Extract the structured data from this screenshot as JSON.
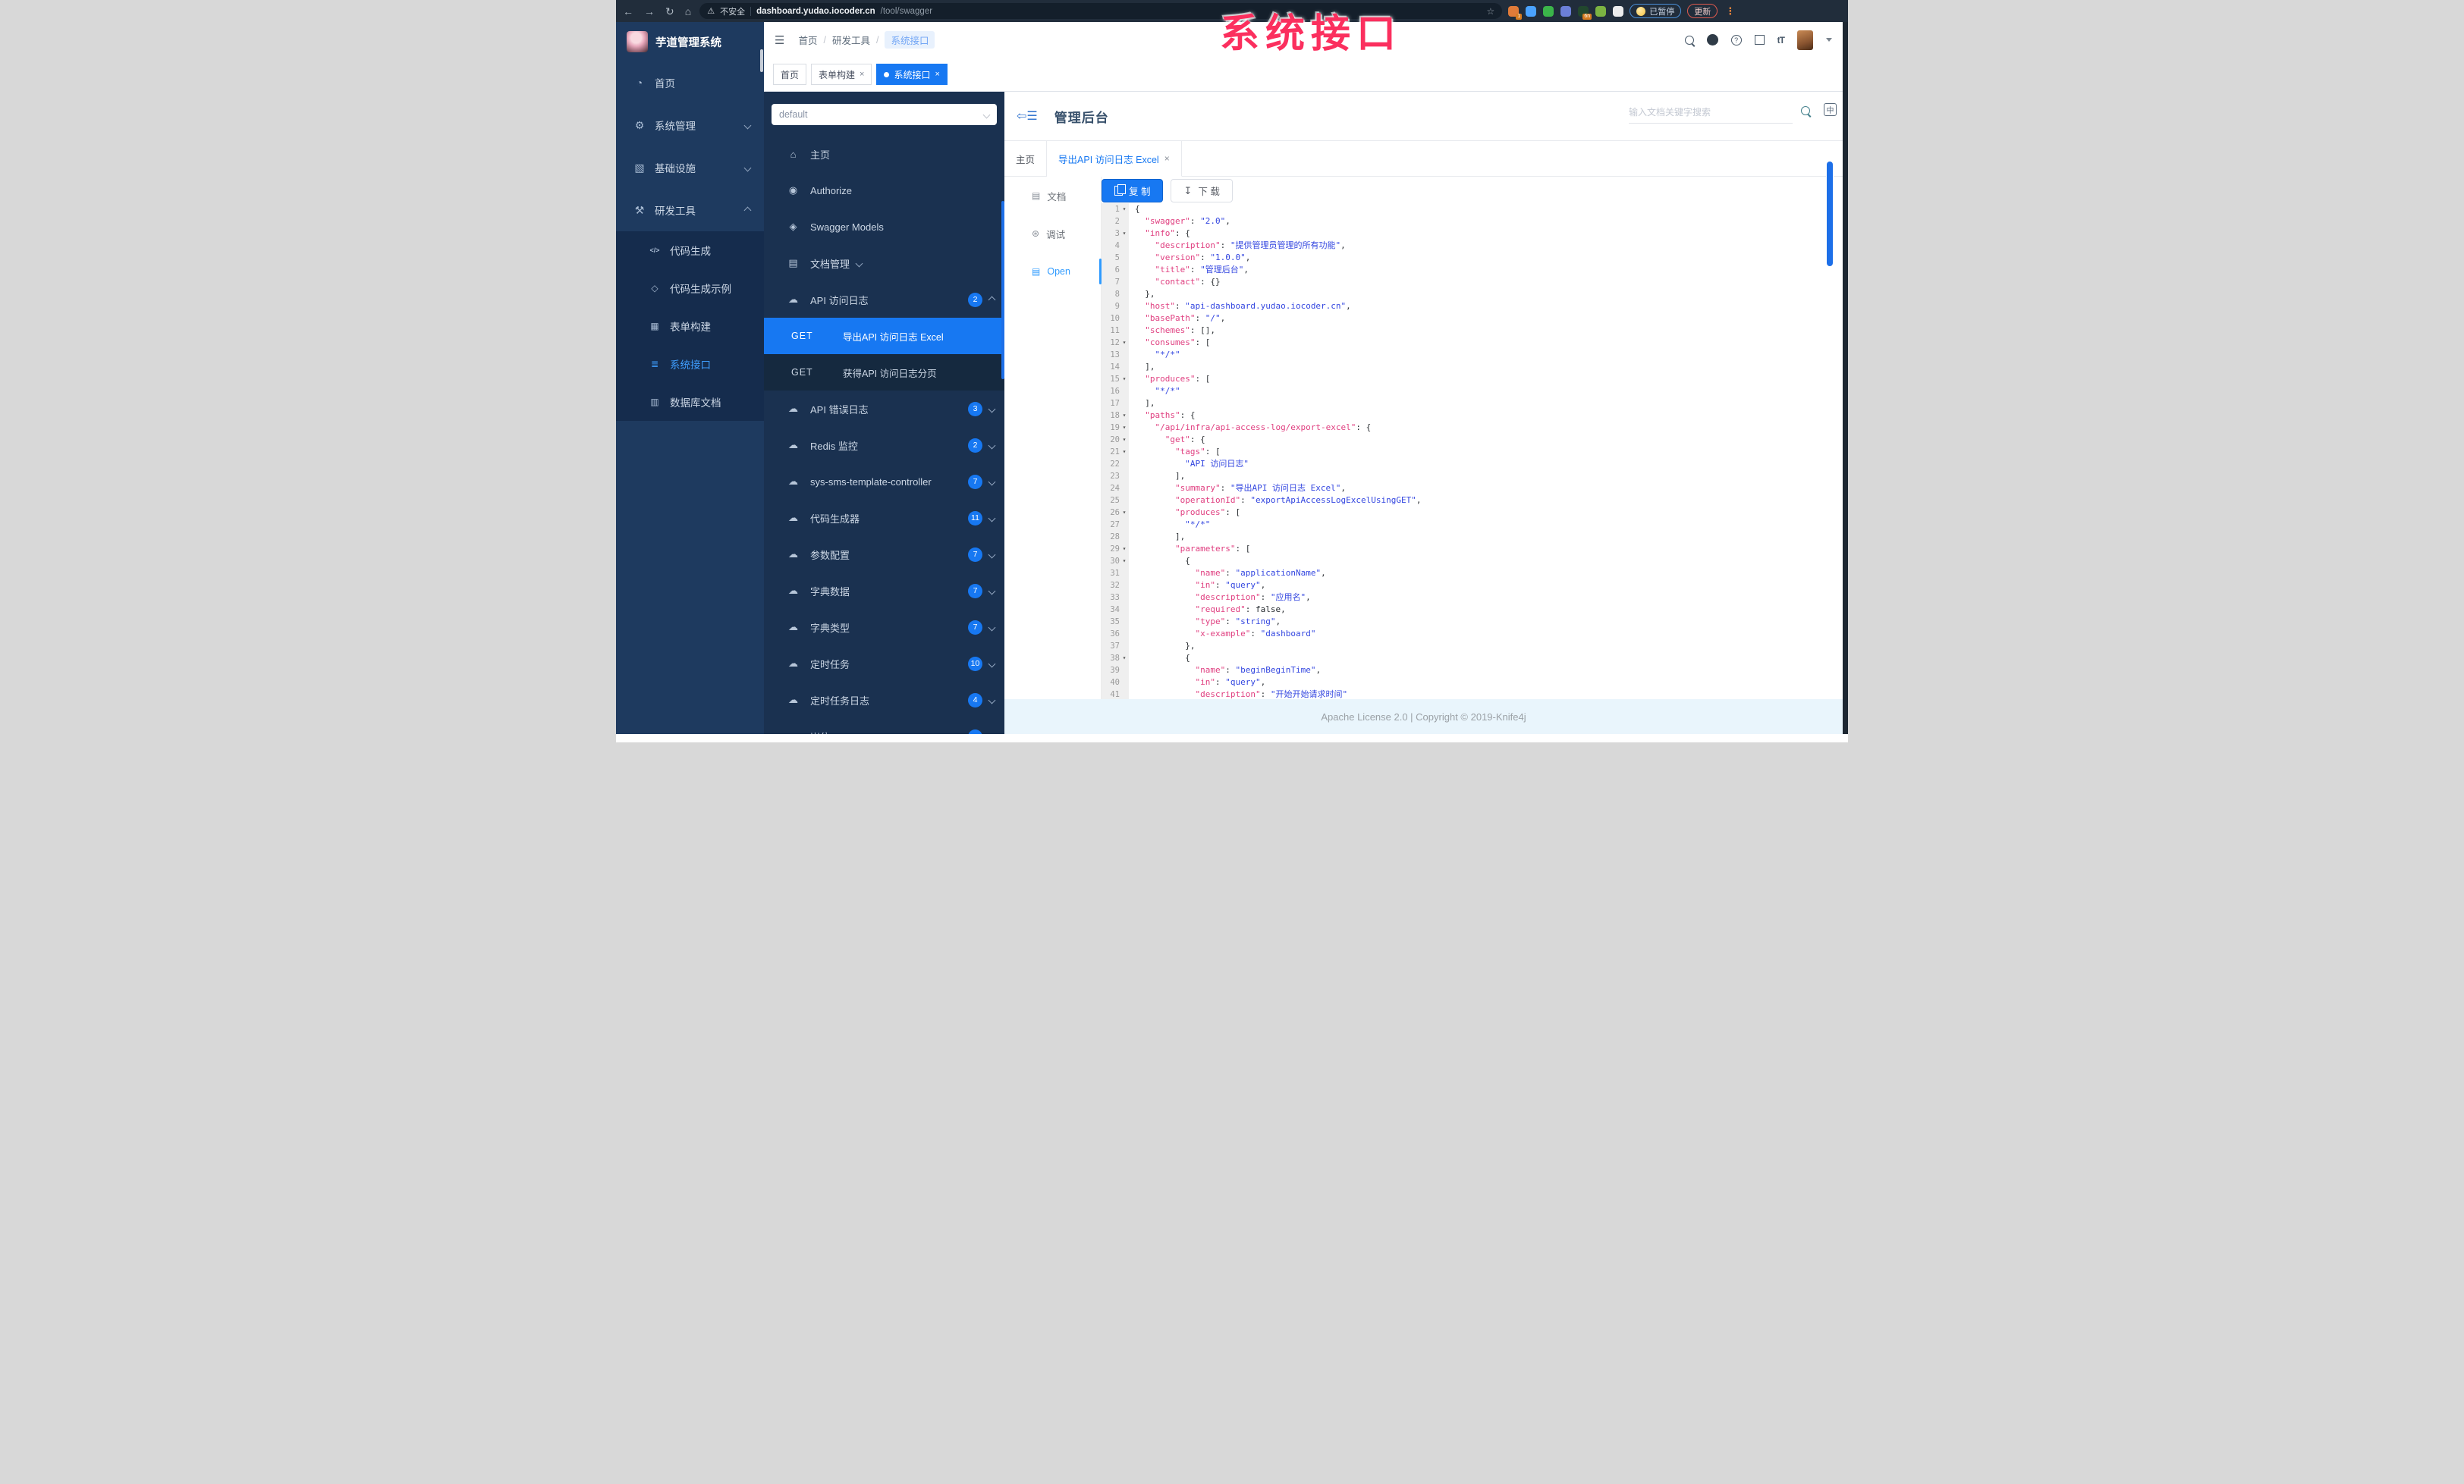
{
  "colors": {
    "accent": "#1778f2",
    "browser-bg": "#212d3b",
    "sidebar-bg": "#1e3a5f",
    "submenu-bg": "#152c4d",
    "panel-bg": "#1a3150",
    "panel-children-bg": "#15293f",
    "active-text": "#3f9eff",
    "overlay-pink": "#fb2f5e",
    "code-key": "#e03f80",
    "code-string": "#3346e0",
    "code-punct": "#2f3337",
    "footer-bg": "#e9f5fc"
  },
  "overlay": {
    "title": "系统接口"
  },
  "browser": {
    "security_label": "不安全",
    "url_host": "dashboard.yudao.iocoder.cn",
    "url_path": "/tool/swagger",
    "paused_label": "已暂停",
    "update_label": "更新",
    "extensions": [
      {
        "name": "extension-1",
        "color": "#e07b39",
        "badge": "1"
      },
      {
        "name": "extension-2",
        "color": "#4aa3ff",
        "badge": null
      },
      {
        "name": "extension-3",
        "color": "#3bb54a",
        "badge": null
      },
      {
        "name": "extension-4",
        "color": "#6b7fd7",
        "badge": null
      },
      {
        "name": "extension-5",
        "color": "#22472e",
        "badge": "6n"
      },
      {
        "name": "extension-6",
        "color": "#7cb342",
        "badge": null
      },
      {
        "name": "extension-7",
        "color": "#ececec",
        "badge": null
      }
    ]
  },
  "app": {
    "logo_title": "芋道管理系统",
    "breadcrumb": [
      "首页",
      "研发工具",
      "系统接口"
    ],
    "page_tabs": [
      {
        "label": "首页",
        "closable": false,
        "active": false
      },
      {
        "label": "表单构建",
        "closable": true,
        "active": false
      },
      {
        "label": "系统接口",
        "closable": true,
        "active": true
      }
    ],
    "sidebar": {
      "items": [
        {
          "label": "首页",
          "icon": "dashboard-icon",
          "chevron": null
        },
        {
          "label": "系统管理",
          "icon": "gear-icon",
          "chevron": "down"
        },
        {
          "label": "基础设施",
          "icon": "infra-icon",
          "chevron": "down"
        },
        {
          "label": "研发工具",
          "icon": "tools-icon",
          "chevron": "up"
        }
      ],
      "sub_items": [
        {
          "label": "代码生成",
          "icon": "code-icon",
          "active": false
        },
        {
          "label": "代码生成示例",
          "icon": "cube-icon",
          "active": false
        },
        {
          "label": "表单构建",
          "icon": "form-icon",
          "active": false
        },
        {
          "label": "系统接口",
          "icon": "api-icon",
          "active": true
        },
        {
          "label": "数据库文档",
          "icon": "database-icon",
          "active": false
        }
      ]
    },
    "swagger_panel": {
      "group_select": "default",
      "nav": [
        {
          "label": "主页",
          "icon": "home-icon"
        },
        {
          "label": "Authorize",
          "icon": "lock-icon"
        },
        {
          "label": "Swagger Models",
          "icon": "models-icon"
        },
        {
          "label": "文档管理",
          "icon": "docs-icon",
          "chevron": "down"
        }
      ],
      "api_groups": [
        {
          "type": "group",
          "label": "API 访问日志",
          "count": "2",
          "chevron": "up"
        },
        {
          "type": "op",
          "method": "GET",
          "label": "导出API 访问日志 Excel",
          "active": true
        },
        {
          "type": "op",
          "method": "GET",
          "label": "获得API 访问日志分页",
          "active": false
        },
        {
          "type": "group",
          "label": "API 错误日志",
          "count": "3",
          "chevron": "down"
        },
        {
          "type": "group",
          "label": "Redis 监控",
          "count": "2",
          "chevron": "down"
        },
        {
          "type": "group",
          "label": "sys-sms-template-controller",
          "count": "7",
          "chevron": "down"
        },
        {
          "type": "group",
          "label": "代码生成器",
          "count": "11",
          "chevron": "down"
        },
        {
          "type": "group",
          "label": "参数配置",
          "count": "7",
          "chevron": "down"
        },
        {
          "type": "group",
          "label": "字典数据",
          "count": "7",
          "chevron": "down"
        },
        {
          "type": "group",
          "label": "字典类型",
          "count": "7",
          "chevron": "down"
        },
        {
          "type": "group",
          "label": "定时任务",
          "count": "10",
          "chevron": "down"
        },
        {
          "type": "group",
          "label": "定时任务日志",
          "count": "4",
          "chevron": "down"
        },
        {
          "type": "group",
          "label": "岗位",
          "count": "",
          "chevron": "down"
        }
      ]
    },
    "main": {
      "title": "管理后台",
      "search_placeholder": "输入文档关键字搜索",
      "lang_icon_label": "中",
      "doc_tabs": [
        {
          "label": "主页",
          "closable": false,
          "active": false
        },
        {
          "label": "导出API 访问日志 Excel",
          "closable": true,
          "active": true
        }
      ],
      "side_tabs": [
        {
          "label": "文档",
          "icon": "document-icon",
          "active": false
        },
        {
          "label": "调试",
          "icon": "bug-icon",
          "active": false
        },
        {
          "label": "Open",
          "icon": "open-file-icon",
          "active": true
        }
      ],
      "copy_label": "复 制",
      "download_label": "下 载",
      "footer": "Apache License 2.0 | Copyright © 2019-Knife4j"
    }
  },
  "code": {
    "lines": [
      {
        "n": 1,
        "i": 0,
        "f": 1,
        "t": [
          [
            "p",
            "{"
          ]
        ]
      },
      {
        "n": 2,
        "i": 2,
        "f": 0,
        "t": [
          [
            "k",
            "\"swagger\""
          ],
          [
            "p",
            ": "
          ],
          [
            "s",
            "\"2.0\""
          ],
          [
            "p",
            ","
          ]
        ]
      },
      {
        "n": 3,
        "i": 2,
        "f": 1,
        "t": [
          [
            "k",
            "\"info\""
          ],
          [
            "p",
            ": {"
          ]
        ]
      },
      {
        "n": 4,
        "i": 4,
        "f": 0,
        "t": [
          [
            "k",
            "\"description\""
          ],
          [
            "p",
            ": "
          ],
          [
            "s",
            "\"提供管理员管理的所有功能\""
          ],
          [
            "p",
            ","
          ]
        ]
      },
      {
        "n": 5,
        "i": 4,
        "f": 0,
        "t": [
          [
            "k",
            "\"version\""
          ],
          [
            "p",
            ": "
          ],
          [
            "s",
            "\"1.0.0\""
          ],
          [
            "p",
            ","
          ]
        ]
      },
      {
        "n": 6,
        "i": 4,
        "f": 0,
        "t": [
          [
            "k",
            "\"title\""
          ],
          [
            "p",
            ": "
          ],
          [
            "s",
            "\"管理后台\""
          ],
          [
            "p",
            ","
          ]
        ]
      },
      {
        "n": 7,
        "i": 4,
        "f": 0,
        "t": [
          [
            "k",
            "\"contact\""
          ],
          [
            "p",
            ": {}"
          ]
        ]
      },
      {
        "n": 8,
        "i": 2,
        "f": 0,
        "t": [
          [
            "p",
            "},"
          ]
        ]
      },
      {
        "n": 9,
        "i": 2,
        "f": 0,
        "t": [
          [
            "k",
            "\"host\""
          ],
          [
            "p",
            ": "
          ],
          [
            "s",
            "\"api-dashboard.yudao.iocoder.cn\""
          ],
          [
            "p",
            ","
          ]
        ]
      },
      {
        "n": 10,
        "i": 2,
        "f": 0,
        "t": [
          [
            "k",
            "\"basePath\""
          ],
          [
            "p",
            ": "
          ],
          [
            "s",
            "\"/\""
          ],
          [
            "p",
            ","
          ]
        ]
      },
      {
        "n": 11,
        "i": 2,
        "f": 0,
        "t": [
          [
            "k",
            "\"schemes\""
          ],
          [
            "p",
            ": [],"
          ]
        ]
      },
      {
        "n": 12,
        "i": 2,
        "f": 1,
        "t": [
          [
            "k",
            "\"consumes\""
          ],
          [
            "p",
            ": ["
          ]
        ]
      },
      {
        "n": 13,
        "i": 4,
        "f": 0,
        "t": [
          [
            "s",
            "\"*/*\""
          ]
        ]
      },
      {
        "n": 14,
        "i": 2,
        "f": 0,
        "t": [
          [
            "p",
            "],"
          ]
        ]
      },
      {
        "n": 15,
        "i": 2,
        "f": 1,
        "t": [
          [
            "k",
            "\"produces\""
          ],
          [
            "p",
            ": ["
          ]
        ]
      },
      {
        "n": 16,
        "i": 4,
        "f": 0,
        "t": [
          [
            "s",
            "\"*/*\""
          ]
        ]
      },
      {
        "n": 17,
        "i": 2,
        "f": 0,
        "t": [
          [
            "p",
            "],"
          ]
        ]
      },
      {
        "n": 18,
        "i": 2,
        "f": 1,
        "t": [
          [
            "k",
            "\"paths\""
          ],
          [
            "p",
            ": {"
          ]
        ]
      },
      {
        "n": 19,
        "i": 4,
        "f": 1,
        "t": [
          [
            "k",
            "\"/api/infra/api-access-log/export-excel\""
          ],
          [
            "p",
            ": {"
          ]
        ]
      },
      {
        "n": 20,
        "i": 6,
        "f": 1,
        "t": [
          [
            "k",
            "\"get\""
          ],
          [
            "p",
            ": {"
          ]
        ]
      },
      {
        "n": 21,
        "i": 8,
        "f": 1,
        "t": [
          [
            "k",
            "\"tags\""
          ],
          [
            "p",
            ": ["
          ]
        ]
      },
      {
        "n": 22,
        "i": 10,
        "f": 0,
        "t": [
          [
            "s",
            "\"API 访问日志\""
          ]
        ]
      },
      {
        "n": 23,
        "i": 8,
        "f": 0,
        "t": [
          [
            "p",
            "],"
          ]
        ]
      },
      {
        "n": 24,
        "i": 8,
        "f": 0,
        "t": [
          [
            "k",
            "\"summary\""
          ],
          [
            "p",
            ": "
          ],
          [
            "s",
            "\"导出API 访问日志 Excel\""
          ],
          [
            "p",
            ","
          ]
        ]
      },
      {
        "n": 25,
        "i": 8,
        "f": 0,
        "t": [
          [
            "k",
            "\"operationId\""
          ],
          [
            "p",
            ": "
          ],
          [
            "s",
            "\"exportApiAccessLogExcelUsingGET\""
          ],
          [
            "p",
            ","
          ]
        ]
      },
      {
        "n": 26,
        "i": 8,
        "f": 1,
        "t": [
          [
            "k",
            "\"produces\""
          ],
          [
            "p",
            ": ["
          ]
        ]
      },
      {
        "n": 27,
        "i": 10,
        "f": 0,
        "t": [
          [
            "s",
            "\"*/*\""
          ]
        ]
      },
      {
        "n": 28,
        "i": 8,
        "f": 0,
        "t": [
          [
            "p",
            "],"
          ]
        ]
      },
      {
        "n": 29,
        "i": 8,
        "f": 1,
        "t": [
          [
            "k",
            "\"parameters\""
          ],
          [
            "p",
            ": ["
          ]
        ]
      },
      {
        "n": 30,
        "i": 10,
        "f": 1,
        "t": [
          [
            "p",
            "{"
          ]
        ]
      },
      {
        "n": 31,
        "i": 12,
        "f": 0,
        "t": [
          [
            "k",
            "\"name\""
          ],
          [
            "p",
            ": "
          ],
          [
            "s",
            "\"applicationName\""
          ],
          [
            "p",
            ","
          ]
        ]
      },
      {
        "n": 32,
        "i": 12,
        "f": 0,
        "t": [
          [
            "k",
            "\"in\""
          ],
          [
            "p",
            ": "
          ],
          [
            "s",
            "\"query\""
          ],
          [
            "p",
            ","
          ]
        ]
      },
      {
        "n": 33,
        "i": 12,
        "f": 0,
        "t": [
          [
            "k",
            "\"description\""
          ],
          [
            "p",
            ": "
          ],
          [
            "s",
            "\"应用名\""
          ],
          [
            "p",
            ","
          ]
        ]
      },
      {
        "n": 34,
        "i": 12,
        "f": 0,
        "t": [
          [
            "k",
            "\"required\""
          ],
          [
            "p",
            ": "
          ],
          [
            "l",
            "false"
          ],
          [
            "p",
            ","
          ]
        ]
      },
      {
        "n": 35,
        "i": 12,
        "f": 0,
        "t": [
          [
            "k",
            "\"type\""
          ],
          [
            "p",
            ": "
          ],
          [
            "s",
            "\"string\""
          ],
          [
            "p",
            ","
          ]
        ]
      },
      {
        "n": 36,
        "i": 12,
        "f": 0,
        "t": [
          [
            "k",
            "\"x-example\""
          ],
          [
            "p",
            ": "
          ],
          [
            "s",
            "\"dashboard\""
          ]
        ]
      },
      {
        "n": 37,
        "i": 10,
        "f": 0,
        "t": [
          [
            "p",
            "},"
          ]
        ]
      },
      {
        "n": 38,
        "i": 10,
        "f": 1,
        "t": [
          [
            "p",
            "{"
          ]
        ]
      },
      {
        "n": 39,
        "i": 12,
        "f": 0,
        "t": [
          [
            "k",
            "\"name\""
          ],
          [
            "p",
            ": "
          ],
          [
            "s",
            "\"beginBeginTime\""
          ],
          [
            "p",
            ","
          ]
        ]
      },
      {
        "n": 40,
        "i": 12,
        "f": 0,
        "t": [
          [
            "k",
            "\"in\""
          ],
          [
            "p",
            ": "
          ],
          [
            "s",
            "\"query\""
          ],
          [
            "p",
            ","
          ]
        ]
      },
      {
        "n": 41,
        "i": 12,
        "f": 0,
        "t": [
          [
            "k",
            "\"description\""
          ],
          [
            "p",
            ": "
          ],
          [
            "s",
            "\"开始开始请求时间\""
          ]
        ]
      }
    ]
  }
}
